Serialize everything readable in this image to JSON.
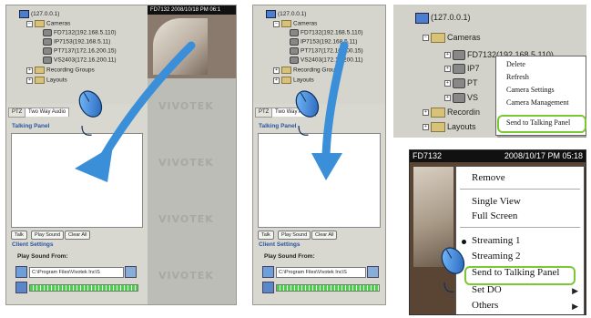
{
  "panel1": {
    "tree": {
      "root": "(127.0.0.1)",
      "cameras": "Cameras",
      "cam_selected": "FD7132(192.168.5.110)",
      "cam2": "IP7153(192.168.5.11)",
      "cam3": "PT7137(172.16.200.15)",
      "cam4": "VS2403(172.16.200.11)",
      "recording_groups": "Recording Groups",
      "layouts": "Layouts"
    },
    "video_header": "FD7132     2008/10/18  PM 06:1",
    "brand": "VIVOTEK",
    "tabs": [
      "PTZ",
      "Two Way Audio"
    ],
    "talking_panel": "Talking Panel",
    "buttons": [
      "Talk",
      "Play Sound",
      "Clear All"
    ],
    "client_settings": "Client Settings",
    "play_sound_from": "Play Sound From:",
    "path": "C:\\Program Files\\Vivotek Inc\\S"
  },
  "panel2": {
    "tree": {
      "root": "(127.0.0.1)",
      "cameras": "Cameras",
      "cam_selected": "FD7132(192.168.5.110)",
      "cam2": "IP7153(192.168.5.11)",
      "cam3": "PT7137(172.16.200.15)",
      "cam4": "VS2403(172.16.200.11)",
      "recording_groups": "Recording Groups",
      "layouts": "Layouts"
    },
    "tabs": [
      "PTZ",
      "Two Way Audio"
    ],
    "talking_panel": "Talking Panel",
    "buttons": [
      "Talk",
      "Play Sound",
      "Clear All"
    ],
    "client_settings": "Client Settings",
    "play_sound_from": "Play Sound From:",
    "path": "C:\\Program Files\\Vivotek Inc\\S"
  },
  "panel3": {
    "root": "(127.0.0.1)",
    "cameras": "Cameras",
    "cam_selected": "FD7132(192.168.5.110)",
    "cam2": "IP7",
    "cam3": "PT",
    "cam4": "VS",
    "recording": "Recordin",
    "layouts": "Layouts",
    "menu": [
      "Delete",
      "Refresh",
      "Camera Settings",
      "Camera Management",
      "Send to Talking Panel"
    ]
  },
  "panel4": {
    "header_cam": "FD7132",
    "header_time": "2008/10/17  PM 05:18",
    "menu": [
      "Remove",
      "Single View",
      "Full Screen",
      "Streaming 1",
      "Streaming 2",
      "Send to Talking Panel",
      "Set DO",
      "Others"
    ]
  },
  "colors": {
    "highlight": "#7cc834",
    "arrow": "#3a8fd8",
    "panel_title": "#2a55a0"
  }
}
